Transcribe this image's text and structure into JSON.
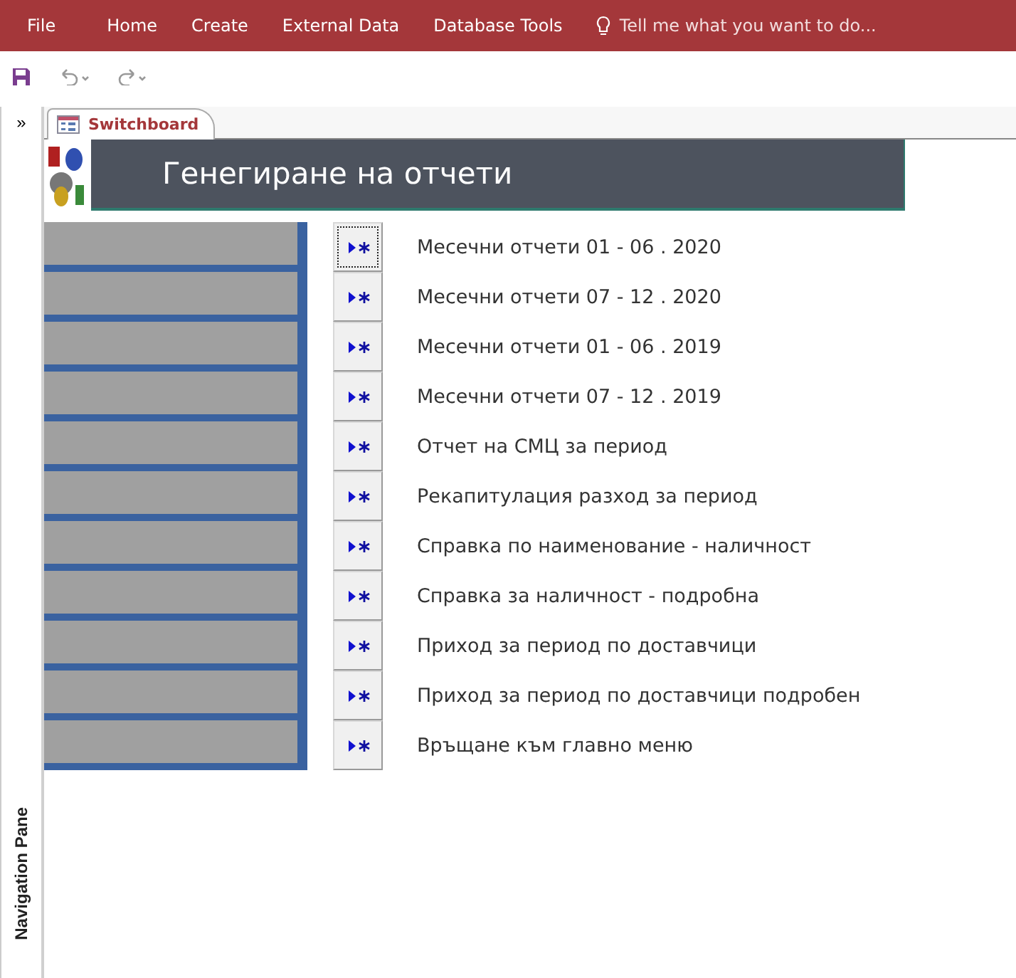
{
  "menu": [
    "File",
    "Home",
    "Create",
    "External Data",
    "Database Tools"
  ],
  "tell_me": {
    "placeholder": "Tell me what you want to do..."
  },
  "navigation_pane": {
    "toggle": "»",
    "label": "Navigation Pane"
  },
  "document_tab": {
    "label": "Switchboard",
    "selected": true
  },
  "header": {
    "title": "Генегиране на отчети"
  },
  "items": [
    {
      "label": "Месечни отчети 01 - 06 . 2020",
      "focused": true
    },
    {
      "label": "Месечни отчети 07 - 12 . 2020",
      "focused": false
    },
    {
      "label": "Месечни отчети 01 - 06 . 2019",
      "focused": false
    },
    {
      "label": "Месечни отчети 07 - 12 . 2019",
      "focused": false
    },
    {
      "label": "Отчет на СМЦ за период",
      "focused": false
    },
    {
      "label": "Рекапитулация разход за период",
      "focused": false
    },
    {
      "label": "Справка по наименование -  наличност",
      "focused": false
    },
    {
      "label": "Справка за наличност - подробна",
      "focused": false
    },
    {
      "label": "Приход за период по доставчици",
      "focused": false
    },
    {
      "label": "Приход за период по доставчици подробен",
      "focused": false
    },
    {
      "label": "Връщане към главно меню",
      "focused": false
    }
  ]
}
